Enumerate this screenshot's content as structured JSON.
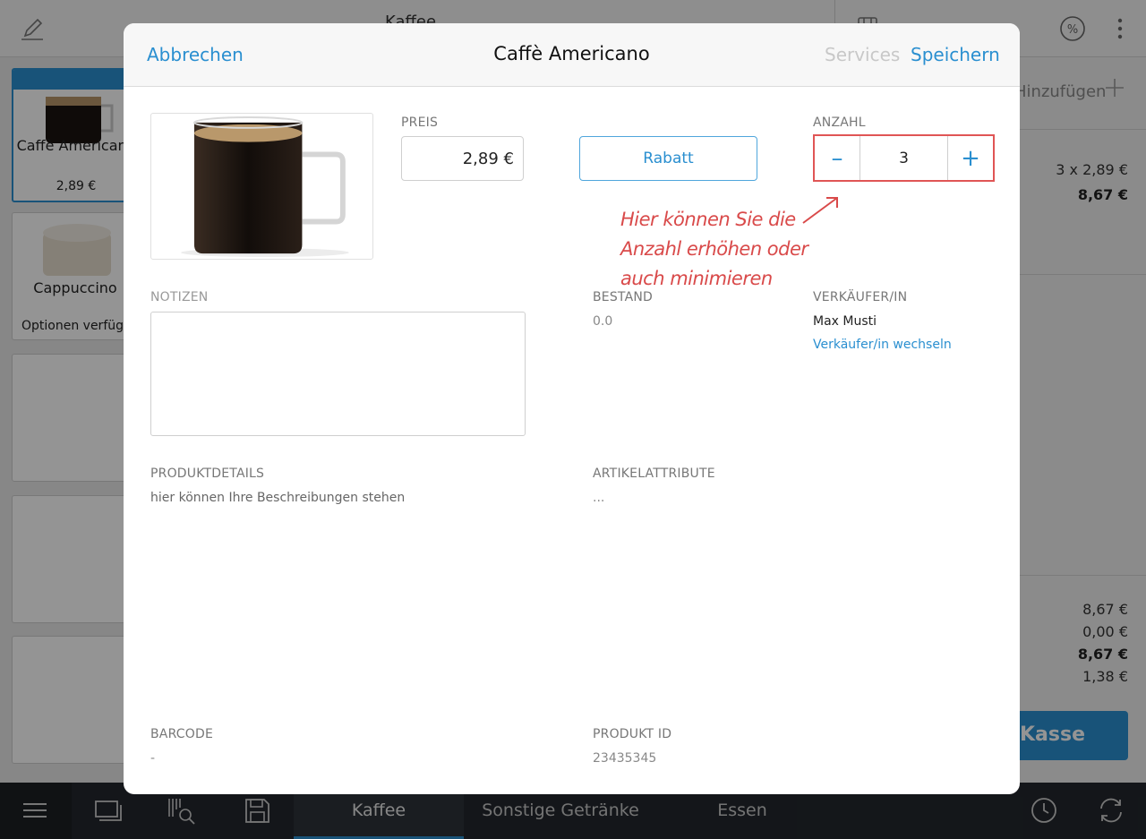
{
  "topbar": {
    "category_title": "Kaffee"
  },
  "tiles": [
    {
      "name": "Caffè Americano",
      "price": "2,89 €"
    },
    {
      "name": "Cappuccino",
      "options": "Optionen verfügbar"
    }
  ],
  "cart": {
    "add_label": "Hinzufügen",
    "item_qty": "3 x 2,89 €",
    "item_total": "8,67 €",
    "summary": [
      "8,67 €",
      "0,00 €",
      "8,67 €",
      "1,38 €"
    ],
    "checkout_label": "Kasse"
  },
  "bottombar": {
    "tabs": [
      {
        "label": "Kaffee",
        "active": true
      },
      {
        "label": "Sonstige Getränke",
        "active": false
      },
      {
        "label": "Essen",
        "active": false
      }
    ]
  },
  "modal": {
    "cancel_label": "Abbrechen",
    "title": "Caffè Americano",
    "services_label": "Services",
    "save_label": "Speichern",
    "price_label": "PREIS",
    "price_value": "2,89 €",
    "discount_label": "Rabatt",
    "quantity_label": "ANZAHL",
    "quantity_value": "3",
    "minus": "–",
    "plus": "+",
    "annotation": "Hier können Sie die Anzahl erhöhen oder auch minimieren",
    "notes_label": "NOTIZEN",
    "stock_label": "BESTAND",
    "stock_value": "0.0",
    "seller_label": "VERKÄUFER/IN",
    "seller_value": "Max Musti",
    "seller_change": "Verkäufer/in wechseln",
    "details_label": "PRODUKTDETAILS",
    "details_value": "hier können Ihre Beschreibungen stehen",
    "attributes_label": "ARTIKELATTRIBUTE",
    "attributes_value": "...",
    "barcode_label": "BARCODE",
    "barcode_value": "-",
    "product_id_label": "PRODUKT ID",
    "product_id_value": "23435345"
  },
  "colors": {
    "accent": "#2a8fd0",
    "annotation": "#d94a4a",
    "bottombar": "#23272d"
  },
  "icons": [
    "edit-icon",
    "cart-icon",
    "percent-icon",
    "more-icon",
    "plus-icon",
    "menu-icon",
    "screen-icon",
    "barcode-search-icon",
    "save-icon",
    "clock-icon",
    "sync-icon"
  ]
}
